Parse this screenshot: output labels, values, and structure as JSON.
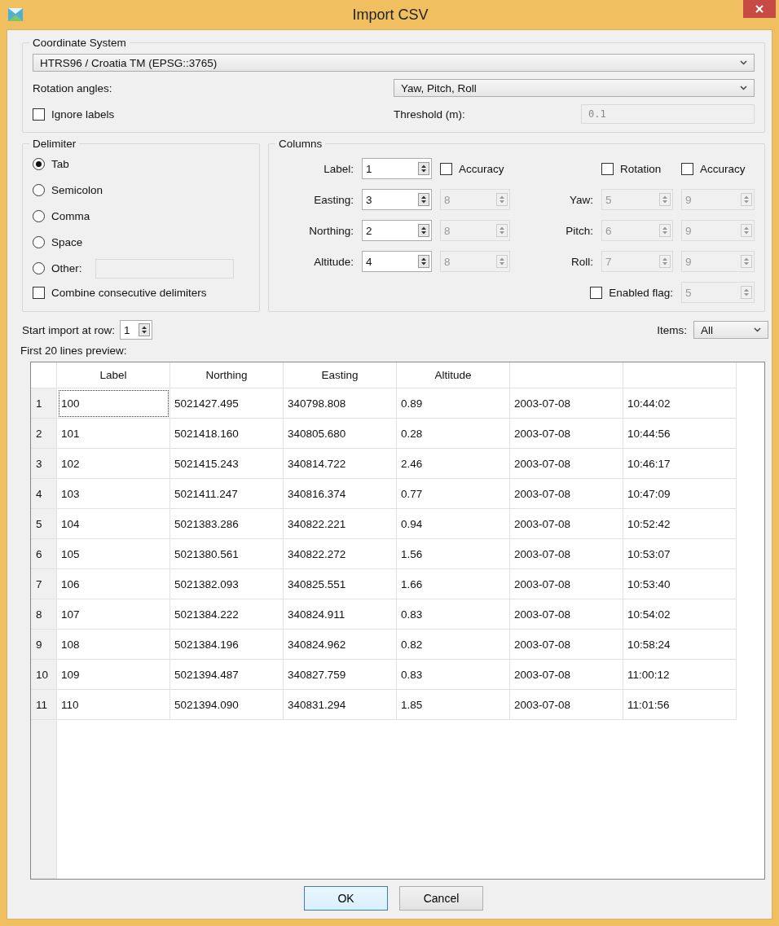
{
  "window": {
    "title": "Import CSV"
  },
  "coordinate_system": {
    "title": "Coordinate System",
    "crs": "HTRS96 / Croatia TM (EPSG::3765)",
    "rotation_label": "Rotation angles:",
    "rotation_value": "Yaw, Pitch, Roll",
    "ignore_labels": {
      "label": "Ignore labels",
      "checked": false
    },
    "threshold_label": "Threshold (m):",
    "threshold": {
      "value": "0.1",
      "disabled": true
    }
  },
  "delimiter": {
    "title": "Delimiter",
    "options": [
      {
        "label": "Tab",
        "selected": true
      },
      {
        "label": "Semicolon",
        "selected": false
      },
      {
        "label": "Comma",
        "selected": false
      },
      {
        "label": "Space",
        "selected": false
      },
      {
        "label": "Other:",
        "selected": false
      }
    ],
    "other_field": {
      "disabled": true
    },
    "combine": {
      "label": "Combine consecutive delimiters",
      "checked": false
    }
  },
  "columns": {
    "title": "Columns",
    "accuracy": {
      "label": "Accuracy",
      "checked": false
    },
    "rotation": {
      "label": "Rotation",
      "checked": false
    },
    "rotation_accuracy": {
      "label": "Accuracy",
      "checked": false
    },
    "left": [
      {
        "label": "Label:",
        "value": "1",
        "disabled": false
      },
      {
        "label": "Easting:",
        "value": "3",
        "disabled": false,
        "accuracy": {
          "value": "8",
          "disabled": true
        }
      },
      {
        "label": "Northing:",
        "value": "2",
        "disabled": false,
        "accuracy": {
          "value": "8",
          "disabled": true
        }
      },
      {
        "label": "Altitude:",
        "value": "4",
        "disabled": false,
        "accuracy": {
          "value": "8",
          "disabled": true
        }
      }
    ],
    "right": [
      {
        "label": "Yaw:",
        "value": "5",
        "disabled": true,
        "accuracy": {
          "value": "9",
          "disabled": true
        }
      },
      {
        "label": "Pitch:",
        "value": "6",
        "disabled": true,
        "accuracy": {
          "value": "9",
          "disabled": true
        }
      },
      {
        "label": "Roll:",
        "value": "7",
        "disabled": true,
        "accuracy": {
          "value": "9",
          "disabled": true
        }
      }
    ],
    "enabled_flag": {
      "label": "Enabled flag:",
      "checked": false,
      "value": "5",
      "disabled": true
    }
  },
  "start_row": {
    "label": "Start import at row:",
    "value": "1"
  },
  "items": {
    "label": "Items:",
    "value": "All"
  },
  "preview": {
    "label": "First 20 lines preview:",
    "columns": [
      "Label",
      "Northing",
      "Easting",
      "Altitude"
    ],
    "rows": [
      {
        "number": "1",
        "cells": [
          "100",
          "5021427.495",
          "340798.808",
          "0.89",
          "2003-07-08",
          "10:44:02"
        ]
      },
      {
        "number": "2",
        "cells": [
          "101",
          "5021418.160",
          "340805.680",
          "0.28",
          "2003-07-08",
          "10:44:56"
        ]
      },
      {
        "number": "3",
        "cells": [
          "102",
          "5021415.243",
          "340814.722",
          "2.46",
          "2003-07-08",
          "10:46:17"
        ]
      },
      {
        "number": "4",
        "cells": [
          "103",
          "5021411.247",
          "340816.374",
          "0.77",
          "2003-07-08",
          "10:47:09"
        ]
      },
      {
        "number": "5",
        "cells": [
          "104",
          "5021383.286",
          "340822.221",
          "0.94",
          "2003-07-08",
          "10:52:42"
        ]
      },
      {
        "number": "6",
        "cells": [
          "105",
          "5021380.561",
          "340822.272",
          "1.56",
          "2003-07-08",
          "10:53:07"
        ]
      },
      {
        "number": "7",
        "cells": [
          "106",
          "5021382.093",
          "340825.551",
          "1.66",
          "2003-07-08",
          "10:53:40"
        ]
      },
      {
        "number": "8",
        "cells": [
          "107",
          "5021384.222",
          "340824.911",
          "0.83",
          "2003-07-08",
          "10:54:02"
        ]
      },
      {
        "number": "9",
        "cells": [
          "108",
          "5021384.196",
          "340824.962",
          "0.82",
          "2003-07-08",
          "10:58:24"
        ]
      },
      {
        "number": "10",
        "cells": [
          "109",
          "5021394.487",
          "340827.759",
          "0.83",
          "2003-07-08",
          "11:00:12"
        ]
      },
      {
        "number": "11",
        "cells": [
          "110",
          "5021394.090",
          "340831.294",
          "1.85",
          "2003-07-08",
          "11:01:56"
        ]
      }
    ]
  },
  "buttons": [
    "OK",
    "Cancel"
  ]
}
